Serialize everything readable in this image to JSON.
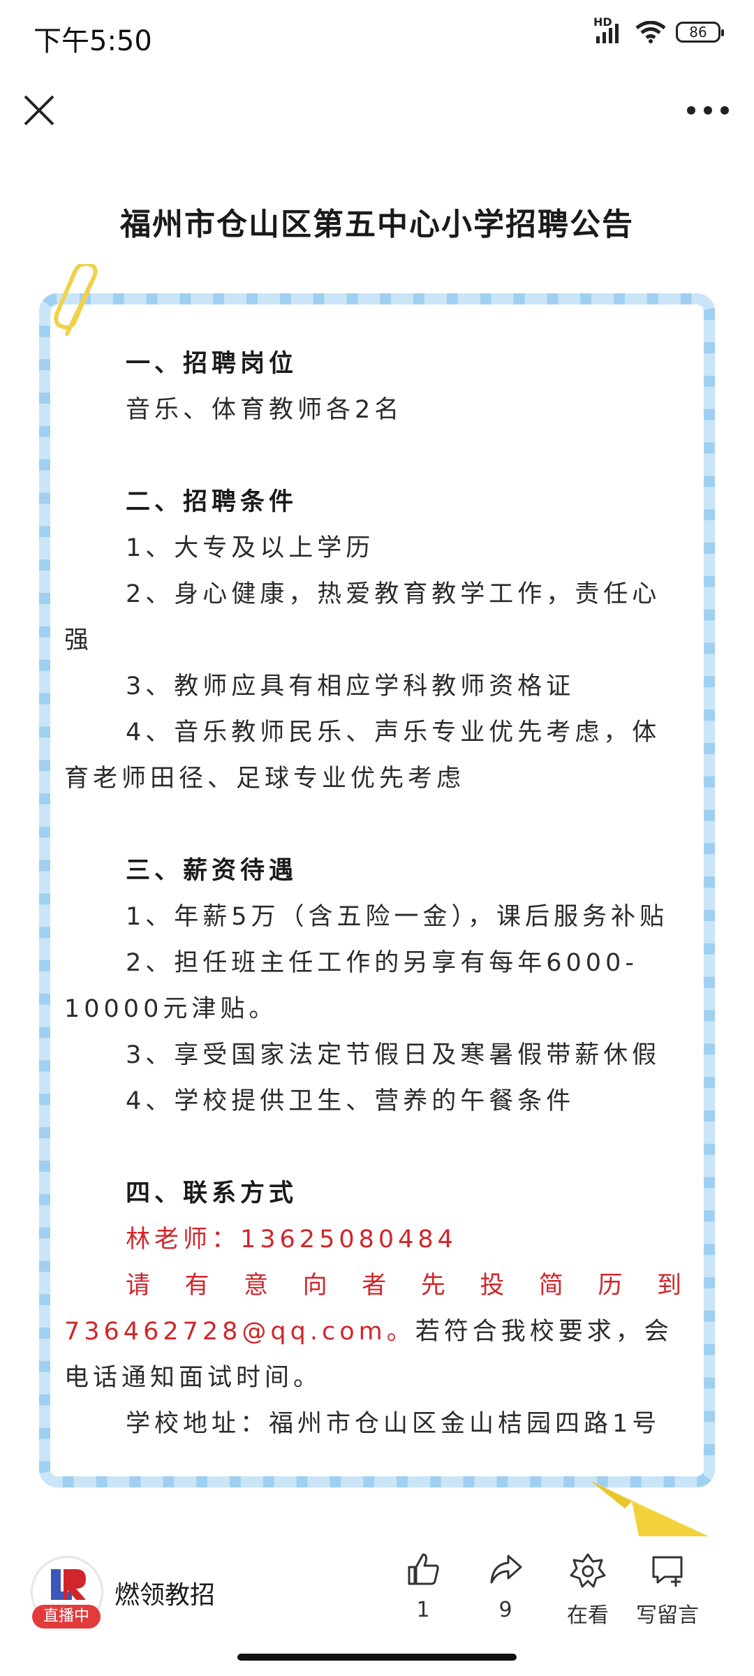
{
  "status_bar": {
    "time": "下午5:50",
    "network": "HD",
    "battery": "86"
  },
  "nav": {
    "close_icon": "close-icon",
    "more_icon": "more-icon"
  },
  "article": {
    "title": "福州市仓山区第五中心小学招聘公告",
    "sections": {
      "positions": {
        "heading": "一、招聘岗位",
        "line1": "音乐、体育教师各2名"
      },
      "conditions": {
        "heading": "二、招聘条件",
        "c1": "1、大专及以上学历",
        "c2": "2、身心健康，热爱教育教学工作，责任心强",
        "c3": "3、教师应具有相应学科教师资格证",
        "c4": "4、音乐教师民乐、声乐专业优先考虑，体育老师田径、足球专业优先考虑"
      },
      "salary": {
        "heading": "三、薪资待遇",
        "s1": "1、年薪5万（含五险一金），课后服务补贴",
        "s2": "2、担任班主任工作的另享有每年6000-10000元津贴。",
        "s3": "3、享受国家法定节假日及寒暑假带薪休假",
        "s4": "4、学校提供卫生、营养的午餐条件"
      },
      "contact": {
        "heading": "四、联系方式",
        "teacher": "林老师：13625080484",
        "resume_red_line1": "请有意向者先投简历到",
        "resume_red_email": "736462728@qq.com。",
        "resume_tail": "若符合我校要求，会电话通知面试时间。",
        "address": "学校地址：福州市仓山区金山桔园四路1号"
      }
    }
  },
  "bottom_bar": {
    "account_name": "燃领教招",
    "live_badge": "直播中",
    "like_count": "1",
    "share_count": "9",
    "watching_label": "在看",
    "comment_label": "写留言"
  },
  "colors": {
    "accent_red": "#d0262b",
    "border_blue": "#9fd0f2"
  }
}
